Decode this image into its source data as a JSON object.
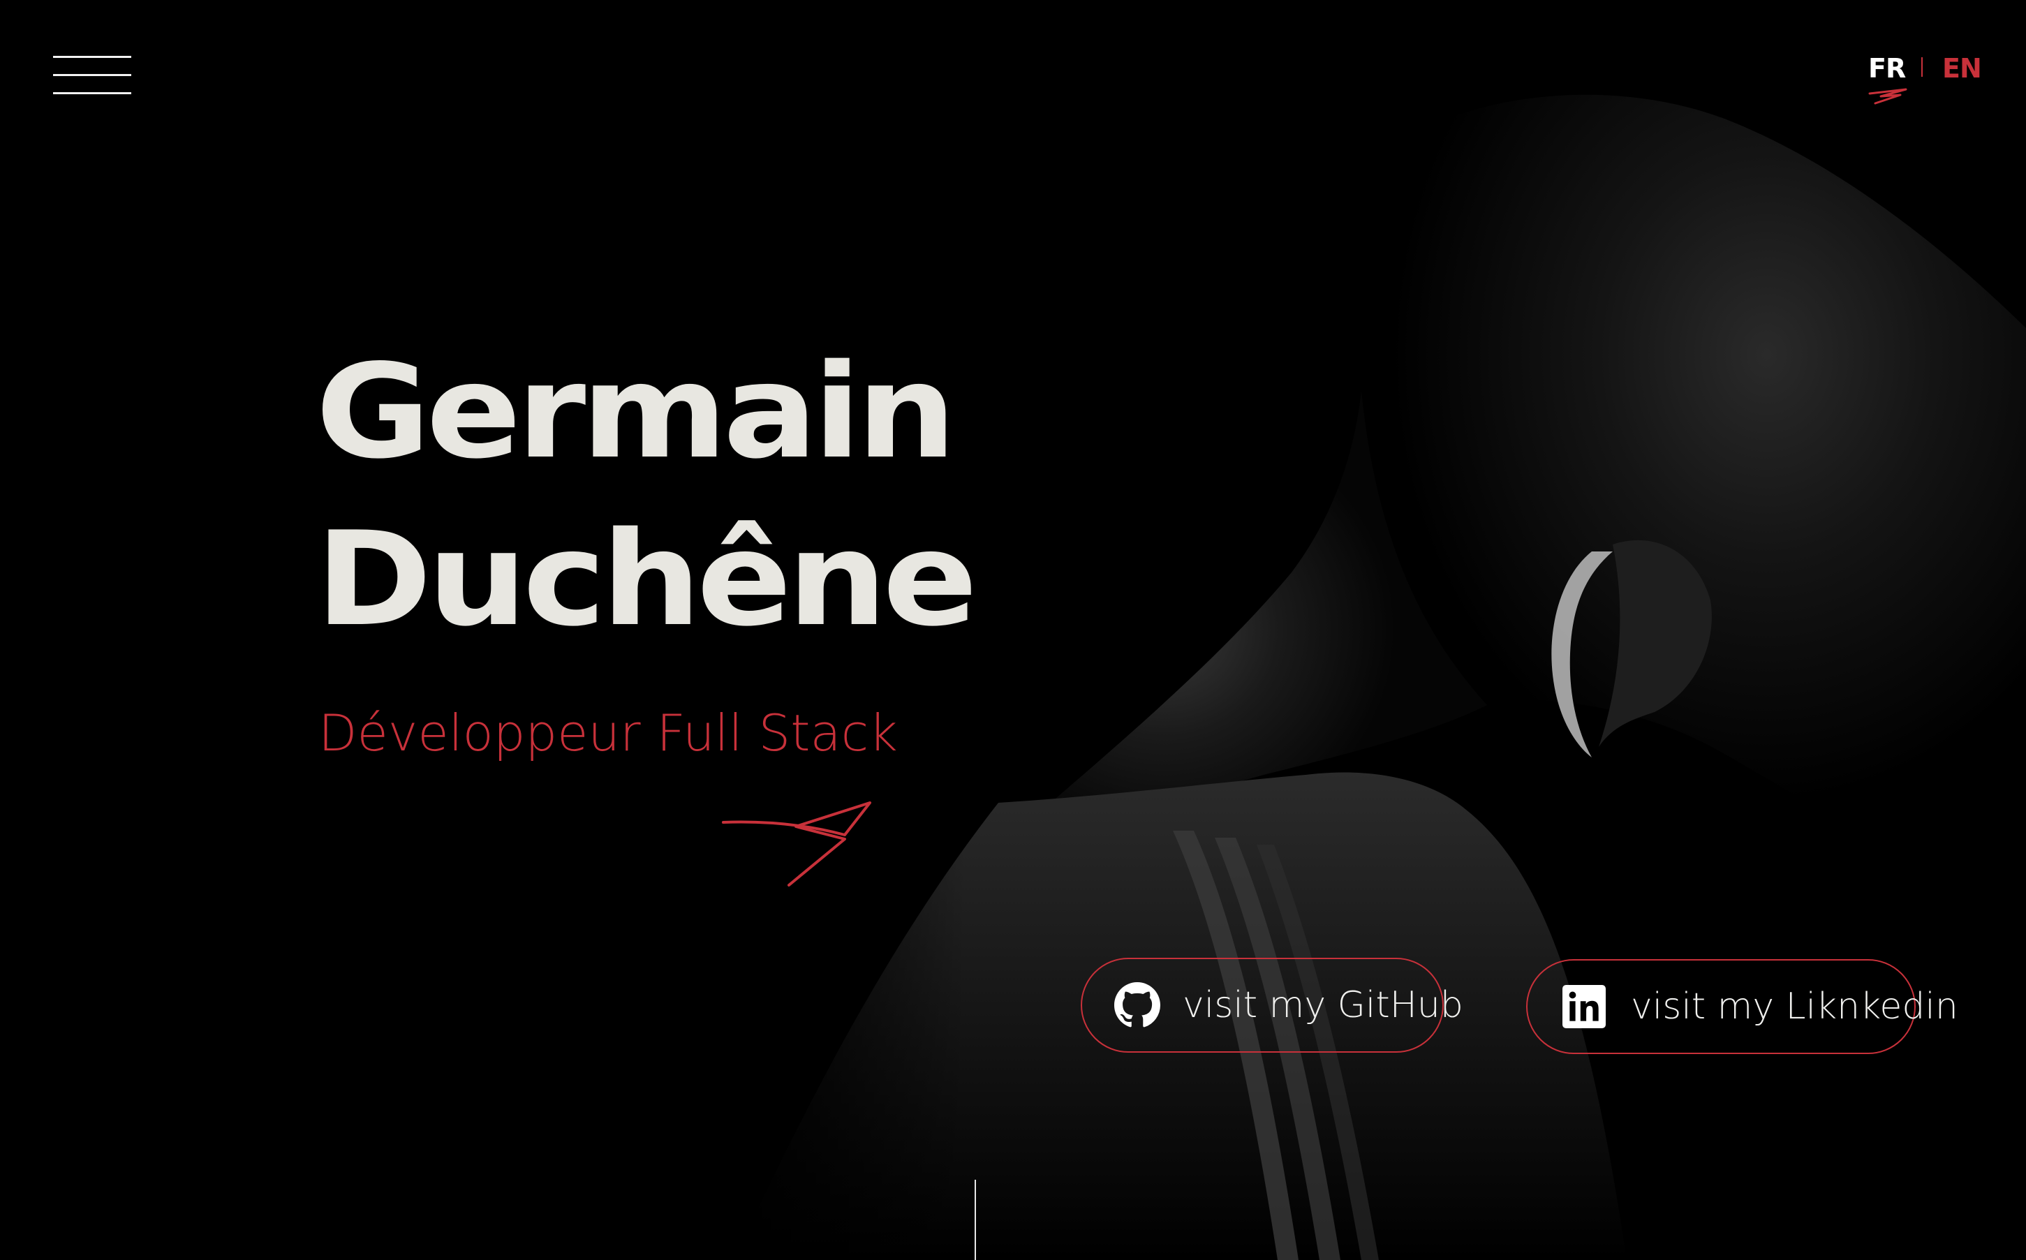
{
  "nav": {
    "menu_label": "menu",
    "languages": {
      "fr": "FR",
      "en": "EN"
    }
  },
  "hero": {
    "first_name": "Germain",
    "last_name": "Duchêne",
    "role": "Développeur Full Stack"
  },
  "buttons": {
    "github_label": "visit my GitHub",
    "linkedin_label": "visit my Liknkedin"
  },
  "icons": {
    "menu": "hamburger-menu-icon",
    "github": "github-icon",
    "linkedin": "linkedin-icon",
    "scribble": "red-scribble-arrow-icon"
  },
  "colors": {
    "background": "#000000",
    "accent": "#c8313a",
    "heading": "#e8e7e1",
    "text": "#f0f0ee"
  }
}
